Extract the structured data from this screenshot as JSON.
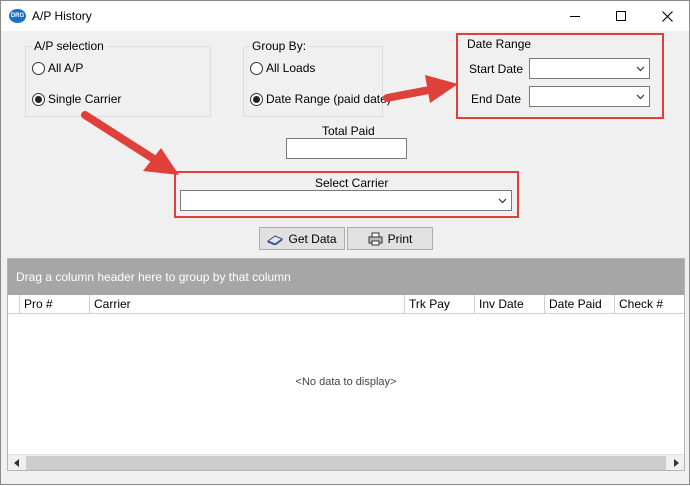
{
  "window": {
    "title": "A/P History",
    "app_icon_text": "DRG"
  },
  "ap_selection": {
    "legend": "A/P selection",
    "options": [
      {
        "label": "All A/P",
        "selected": false
      },
      {
        "label": "Single Carrier",
        "selected": true
      }
    ]
  },
  "group_by": {
    "legend": "Group By:",
    "options": [
      {
        "label": "All Loads",
        "selected": false
      },
      {
        "label": "Date Range (paid date)",
        "selected": true
      }
    ]
  },
  "date_range": {
    "legend": "Date Range",
    "start_label": "Start Date",
    "start_value": "",
    "end_label": "End Date",
    "end_value": ""
  },
  "total_paid": {
    "label": "Total Paid",
    "value": ""
  },
  "select_carrier": {
    "label": "Select Carrier",
    "value": ""
  },
  "buttons": {
    "get_data": "Get Data",
    "print": "Print"
  },
  "grid": {
    "group_panel_text": "Drag a column header here to group by that column",
    "columns": [
      "Pro #",
      "Carrier",
      "Trk Pay",
      "Inv Date",
      "Date Paid",
      "Check #"
    ],
    "empty_text": "<No data to display>"
  },
  "colors": {
    "highlight": "#e0403a",
    "group_panel": "#a6a6a6",
    "window_bg": "#f0f0f0"
  }
}
